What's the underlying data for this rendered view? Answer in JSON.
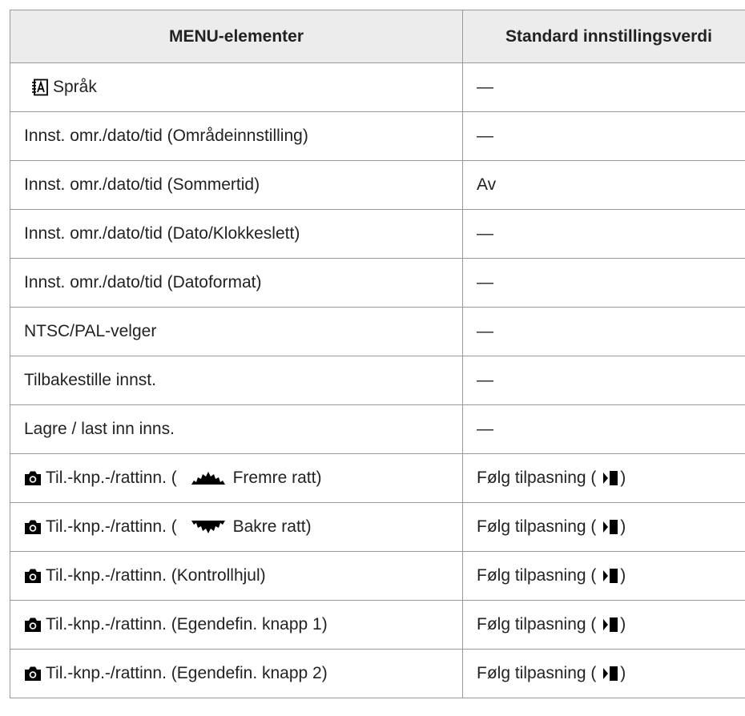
{
  "table": {
    "headers": [
      "MENU-elementer",
      "Standard innstillingsverdi"
    ],
    "rows": [
      {
        "icon": "language-icon",
        "label": "Språk",
        "value": "—"
      },
      {
        "label": "Innst. omr./dato/tid (Områdeinnstilling)",
        "value": "—"
      },
      {
        "label": "Innst. omr./dato/tid (Sommertid)",
        "value": "Av"
      },
      {
        "label": "Innst. omr./dato/tid (Dato/Klokkeslett)",
        "value": "—"
      },
      {
        "label": "Innst. omr./dato/tid (Datoformat)",
        "value": "—"
      },
      {
        "label": "NTSC/PAL-velger",
        "value": "—"
      },
      {
        "label": "Tilbakestille innst.",
        "value": "—"
      },
      {
        "label": "Lagre / last inn inns.",
        "value": "—"
      },
      {
        "icon": "camera-icon",
        "label_pre": "Til.-knp.-/rattinn. (",
        "dial_icon": "front-dial-icon",
        "label_post": "Fremre ratt)",
        "value_pre": "Følg tilpasning (",
        "value_icon": "stills-movie-icon",
        "value_post": ")"
      },
      {
        "icon": "camera-icon",
        "label_pre": "Til.-knp.-/rattinn. (",
        "dial_icon": "rear-dial-icon",
        "label_post": "Bakre ratt)",
        "value_pre": "Følg tilpasning (",
        "value_icon": "stills-movie-icon",
        "value_post": ")"
      },
      {
        "icon": "camera-icon",
        "label": "Til.-knp.-/rattinn. (Kontrollhjul)",
        "value_pre": "Følg tilpasning (",
        "value_icon": "stills-movie-icon",
        "value_post": ")"
      },
      {
        "icon": "camera-icon",
        "label": "Til.-knp.-/rattinn. (Egendefin. knapp 1)",
        "value_pre": "Følg tilpasning (",
        "value_icon": "stills-movie-icon",
        "value_post": ")"
      },
      {
        "icon": "camera-icon",
        "label": "Til.-knp.-/rattinn. (Egendefin. knapp 2)",
        "value_pre": "Følg tilpasning (",
        "value_icon": "stills-movie-icon",
        "value_post": ")"
      }
    ]
  }
}
